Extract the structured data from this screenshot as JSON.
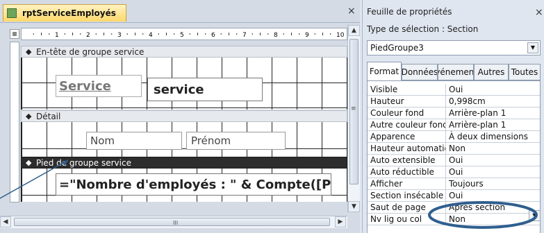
{
  "report": {
    "tab_title": "rptServiceEmployés",
    "close": "×",
    "ruler_labels": [
      "1",
      "2",
      "3",
      "4",
      "5",
      "6",
      "7",
      "8",
      "9",
      "10"
    ],
    "sections": {
      "header": "En-tête de groupe service",
      "detail": "Détail",
      "footer": "Pied de groupe service"
    },
    "controls": {
      "service_label": "Service",
      "service_field": "service",
      "nom_label": "Nom",
      "prenom_field": "Prénom",
      "count_field": "=\"Nombre d'employés : \" & Compte([Prénom])"
    },
    "scroll": {
      "up": "▲",
      "down": "▼",
      "left": "◀",
      "right": "▶",
      "grip_h": "III",
      "grip_v": "≡"
    }
  },
  "property_sheet": {
    "title": "Feuille de propriétés",
    "close": "×",
    "selection_type": "Type de sélection :  Section",
    "selected_object": "PiedGroupe3",
    "dropdown_arrow": "▼",
    "tabs": [
      "Format",
      "Données",
      "Événements",
      "Autres",
      "Toutes"
    ],
    "active_tab": "Format",
    "properties": [
      {
        "name": "Visible",
        "value": "Oui"
      },
      {
        "name": "Hauteur",
        "value": "0,998cm"
      },
      {
        "name": "Couleur fond",
        "value": "Arrière-plan 1"
      },
      {
        "name": "Autre couleur fond",
        "value": "Arrière-plan 1"
      },
      {
        "name": "Apparence",
        "value": "À deux dimensions"
      },
      {
        "name": "Hauteur automatique",
        "value": "Non"
      },
      {
        "name": "Auto extensible",
        "value": "Oui"
      },
      {
        "name": "Auto réductible",
        "value": "Oui"
      },
      {
        "name": "Afficher",
        "value": "Toujours"
      },
      {
        "name": "Section insécable",
        "value": "Oui"
      },
      {
        "name": "Saut de page",
        "value": "Après section"
      },
      {
        "name": "Nv lig ou col",
        "value": "Non"
      }
    ]
  },
  "colors": {
    "annotation": "#2f5f8f",
    "tab_active": "#ffd86a",
    "footer_bar": "#2d2d2d"
  }
}
